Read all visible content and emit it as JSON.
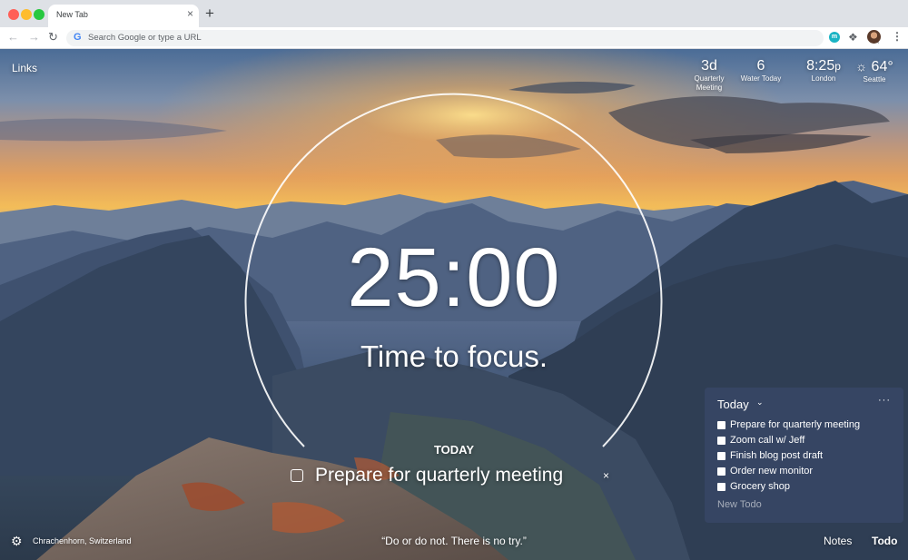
{
  "browser": {
    "tab_title": "New Tab",
    "tab_close": "×",
    "new_tab": "+",
    "omnibox_placeholder": "Search Google or type a URL",
    "extension_badge": "m"
  },
  "top_left": {
    "links_label": "Links"
  },
  "widgets": {
    "countdown": {
      "value": "3d",
      "label_line1": "Quarterly",
      "label_line2": "Meeting"
    },
    "water": {
      "value": "6",
      "label": "Water Today"
    },
    "clock": {
      "time": "8:25",
      "suffix": "p",
      "label": "London"
    },
    "weather": {
      "icon": "sun-icon",
      "temp": "64°",
      "label": "Seattle"
    }
  },
  "focus": {
    "timer": "25:00",
    "message": "Time to focus.",
    "today_label": "TODAY",
    "task": "Prepare for quarterly meeting",
    "close": "×"
  },
  "todo_panel": {
    "header": "Today",
    "more": "···",
    "items": [
      {
        "label": "Prepare for quarterly meeting"
      },
      {
        "label": "Zoom call w/ Jeff"
      },
      {
        "label": "Finish blog post draft"
      },
      {
        "label": "Order new monitor"
      },
      {
        "label": "Grocery shop"
      }
    ],
    "new_placeholder": "New Todo"
  },
  "footer": {
    "location": "Chrachenhorn, Switzerland",
    "quote": "“Do or do not. There is no try.”",
    "notes_label": "Notes",
    "todo_label": "Todo"
  },
  "colors": {
    "panel": "#374664",
    "accent_sun": "#f3bd59"
  }
}
